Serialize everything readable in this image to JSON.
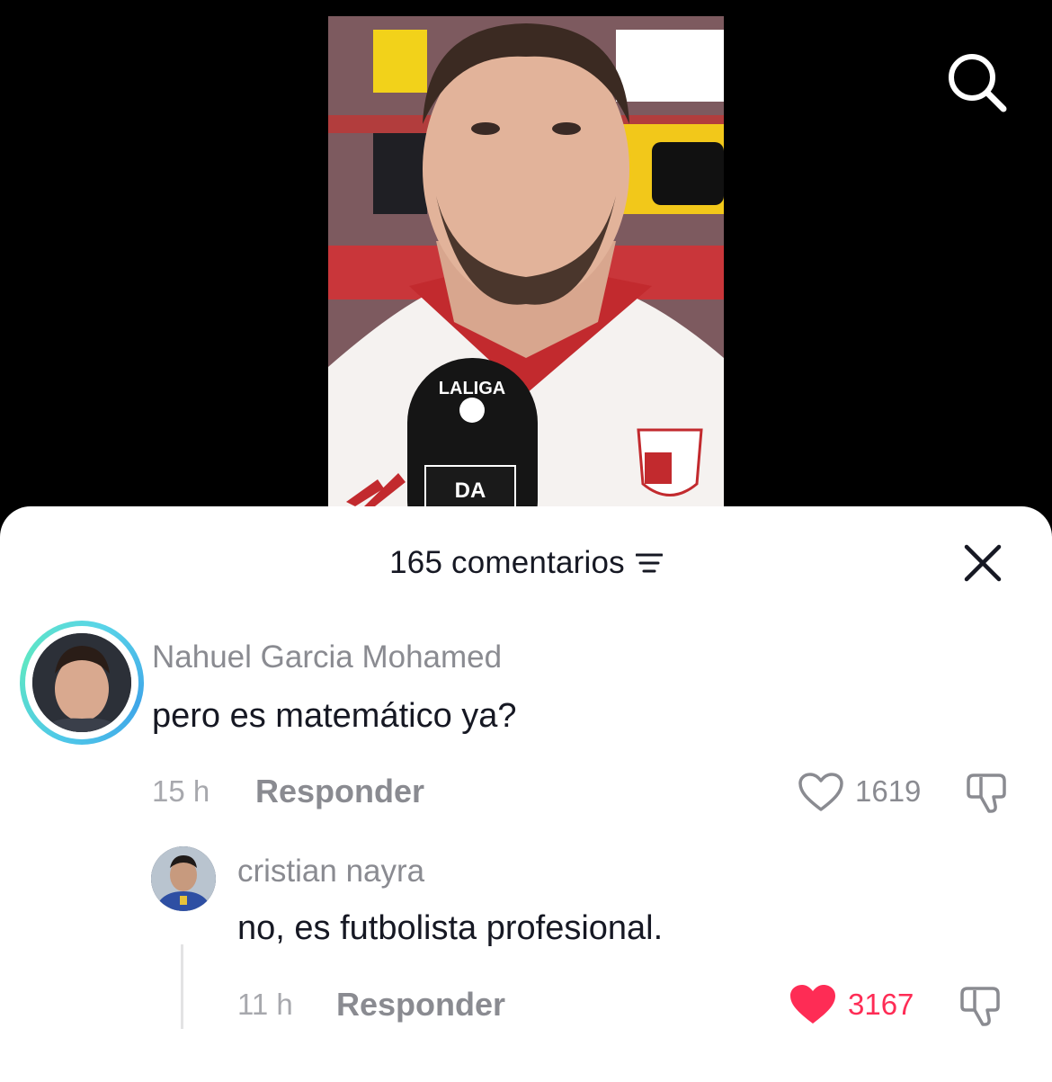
{
  "sheet": {
    "title": "165 comentarios",
    "sort_icon": "sort-lines-icon",
    "close_icon": "close-icon"
  },
  "top_bar": {
    "search_icon": "search-icon"
  },
  "video": {
    "subject": "football player interview with microphone"
  },
  "comments": [
    {
      "username": "Nahuel Garcia Mohamed",
      "text": "pero es matemático ya?",
      "time": "15 h",
      "reply_label": "Responder",
      "likes": "1619",
      "liked": false
    }
  ],
  "replies": [
    {
      "username": "cristian nayra",
      "text": "no, es futbolista profesional.",
      "time": "11 h",
      "reply_label": "Responder",
      "likes": "3167",
      "liked": true
    }
  ],
  "colors": {
    "liked_red": "#fe2c55",
    "muted_gray": "#8a8b91",
    "text_dark": "#161823"
  }
}
